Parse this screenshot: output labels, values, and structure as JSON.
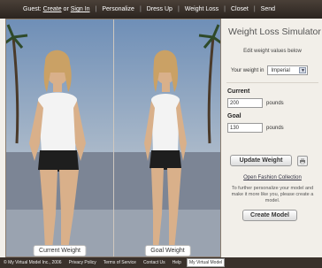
{
  "nav": {
    "guest": "Guest:",
    "create": "Create",
    "or": "or",
    "sign_in": "Sign In",
    "items": [
      "Personalize",
      "Dress Up",
      "Weight Loss",
      "Closet",
      "Send"
    ]
  },
  "viewer": {
    "left_caption": "Current Weight",
    "right_caption": "Goal Weight"
  },
  "sidebar": {
    "title": "Weight Loss Simulator",
    "subtitle": "Edit weight values below",
    "unit_label": "Your weight in",
    "unit_value": "Imperial",
    "current_label": "Current",
    "current_value": "200",
    "current_unit": "pounds",
    "goal_label": "Goal",
    "goal_value": "130",
    "goal_unit": "pounds",
    "update_button": "Update Weight",
    "fashion_link": "Open Fashion Collection",
    "blurb": "To further personalize your model and make it more like you, please create a model.",
    "create_button": "Create Model"
  },
  "footer": {
    "copyright": "© My Virtual Model Inc., 2006",
    "links": [
      "Privacy Policy",
      "Terms of Service",
      "Contact Us",
      "Help"
    ],
    "badge": "My Virtual Model"
  }
}
